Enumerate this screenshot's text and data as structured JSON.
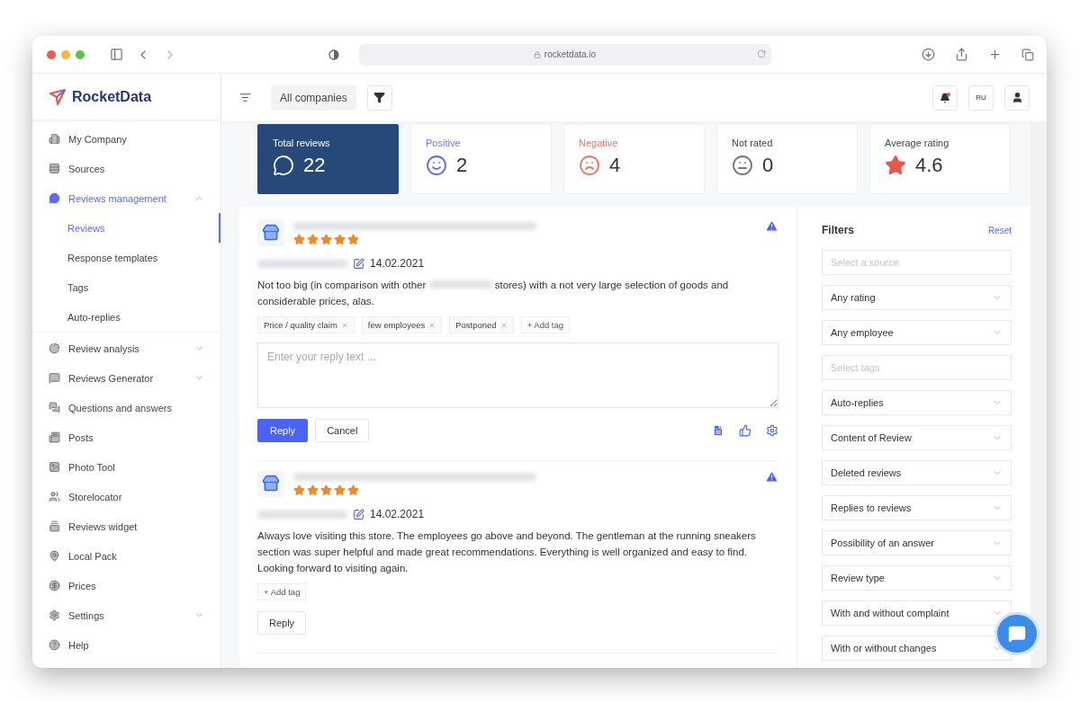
{
  "browser": {
    "url": "rocketdata.io"
  },
  "sidebar": {
    "logo": "RocketData",
    "items": [
      {
        "label": "My Company",
        "kind": "link",
        "selected": false
      },
      {
        "label": "Sources",
        "kind": "link",
        "selected": false
      },
      {
        "label": "Reviews management",
        "kind": "group",
        "selected": true,
        "expanded": true,
        "children": [
          {
            "label": "Reviews",
            "selected": true
          },
          {
            "label": "Response templates",
            "selected": false
          },
          {
            "label": "Tags",
            "selected": false
          },
          {
            "label": "Auto-replies",
            "selected": false
          }
        ]
      },
      {
        "label": "Review analysis",
        "kind": "group",
        "selected": false,
        "expanded": false
      },
      {
        "label": "Reviews Generator",
        "kind": "group",
        "selected": false,
        "expanded": false
      },
      {
        "label": "Questions and answers",
        "kind": "link",
        "selected": false
      },
      {
        "label": "Posts",
        "kind": "link",
        "selected": false
      },
      {
        "label": "Photo Tool",
        "kind": "link",
        "selected": false
      },
      {
        "label": "Storelocator",
        "kind": "link",
        "selected": false
      },
      {
        "label": "Reviews widget",
        "kind": "link",
        "selected": false
      },
      {
        "label": "Local Pack",
        "kind": "link",
        "selected": false
      },
      {
        "label": "Prices",
        "kind": "link",
        "selected": false
      },
      {
        "label": "Settings",
        "kind": "group",
        "selected": false,
        "expanded": false
      },
      {
        "label": "Help",
        "kind": "link",
        "selected": false
      }
    ]
  },
  "topbar": {
    "company": "All companies",
    "language": "RU"
  },
  "stats": [
    {
      "kind": "total",
      "label": "Total reviews",
      "value": "22",
      "selected": true
    },
    {
      "kind": "positive",
      "label": "Positive",
      "value": "2",
      "selected": false
    },
    {
      "kind": "negative",
      "label": "Negative",
      "value": "4",
      "selected": false
    },
    {
      "kind": "neutral",
      "label": "Not rated",
      "value": "0",
      "selected": false
    },
    {
      "kind": "rating",
      "label": "Average rating",
      "value": "4.6",
      "selected": false
    }
  ],
  "reviews": [
    {
      "stars": 5,
      "date": "14.02.2021",
      "text_before": "Not too big (in comparison with other",
      "text_after": "stores) with a not very large selection of goods and considerable prices, alas.",
      "tags": [
        "Price / quality claim",
        "few employees",
        "Postponed"
      ],
      "add_tag": "+ Add tag",
      "reply_box": {
        "placeholder": "Enter your reply text ...",
        "submit": "Reply",
        "cancel": "Cancel"
      }
    },
    {
      "stars": 5,
      "date": "14.02.2021",
      "text_after": "Always love visiting this store. The employees go above and beyond. The gentleman at the running sneakers section was super helpful and made great recommendations. Everything is well organized and easy to find. Looking forward to visiting again.",
      "add_tag": "+ Add tag",
      "reply_button": "Reply"
    }
  ],
  "filters": {
    "title": "Filters",
    "reset": "Reset",
    "fields": [
      {
        "kind": "input",
        "placeholder": "Select a source"
      },
      {
        "kind": "select",
        "value": "Any rating"
      },
      {
        "kind": "select",
        "value": "Any employee"
      },
      {
        "kind": "input",
        "placeholder": "Select tags"
      },
      {
        "kind": "select",
        "value": "Auto-replies"
      },
      {
        "kind": "select",
        "value": "Content of Review"
      },
      {
        "kind": "select",
        "value": "Deleted reviews"
      },
      {
        "kind": "select",
        "value": "Replies to reviews"
      },
      {
        "kind": "select",
        "value": "Possibility of an answer"
      },
      {
        "kind": "select",
        "value": "Review type"
      },
      {
        "kind": "select",
        "value": "With and without complaint"
      },
      {
        "kind": "select",
        "value": "With or without changes"
      }
    ]
  }
}
